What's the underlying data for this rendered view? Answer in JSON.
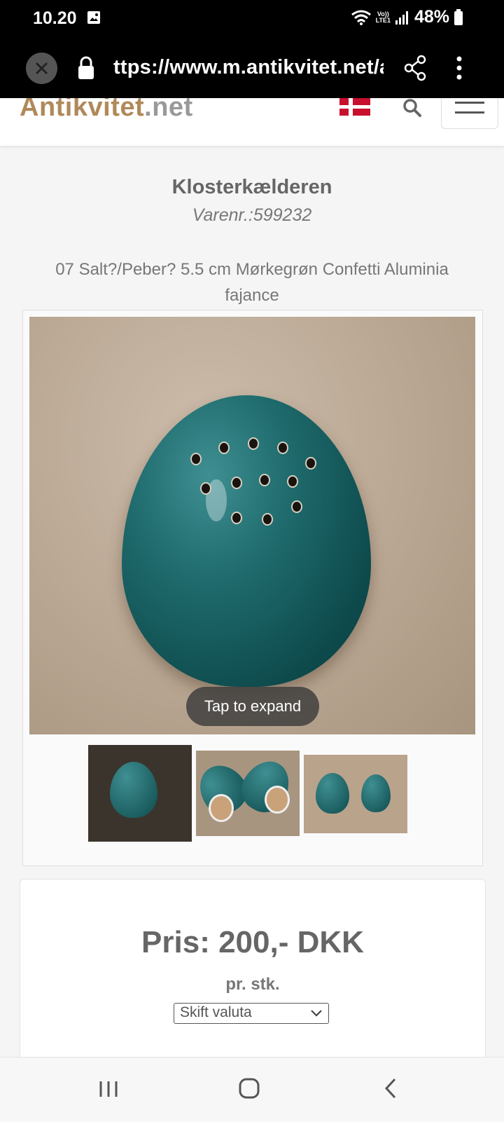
{
  "status": {
    "time": "10.20",
    "volte_top": "Vo))",
    "volte_bottom": "LTE1",
    "battery_pct": "48%"
  },
  "browser": {
    "url": "ttps://www.m.antikvitet.net/a"
  },
  "site": {
    "logo_main": "Antikvitet",
    "logo_suffix": ".net"
  },
  "product": {
    "seller": "Klosterkælderen",
    "sku": "Varenr.:599232",
    "title": "07 Salt?/Peber? 5.5 cm Mørkegrøn Confetti Aluminia fajance",
    "tap_to_expand": "Tap to expand"
  },
  "pricing": {
    "price": "Pris: 200,- DKK",
    "per_unit": "pr. stk.",
    "currency_select": "Skift valuta"
  },
  "colors": {
    "brand_gold": "#b0895a",
    "egg_teal": "#1f6b6d",
    "denmark_red": "#c8102e"
  }
}
